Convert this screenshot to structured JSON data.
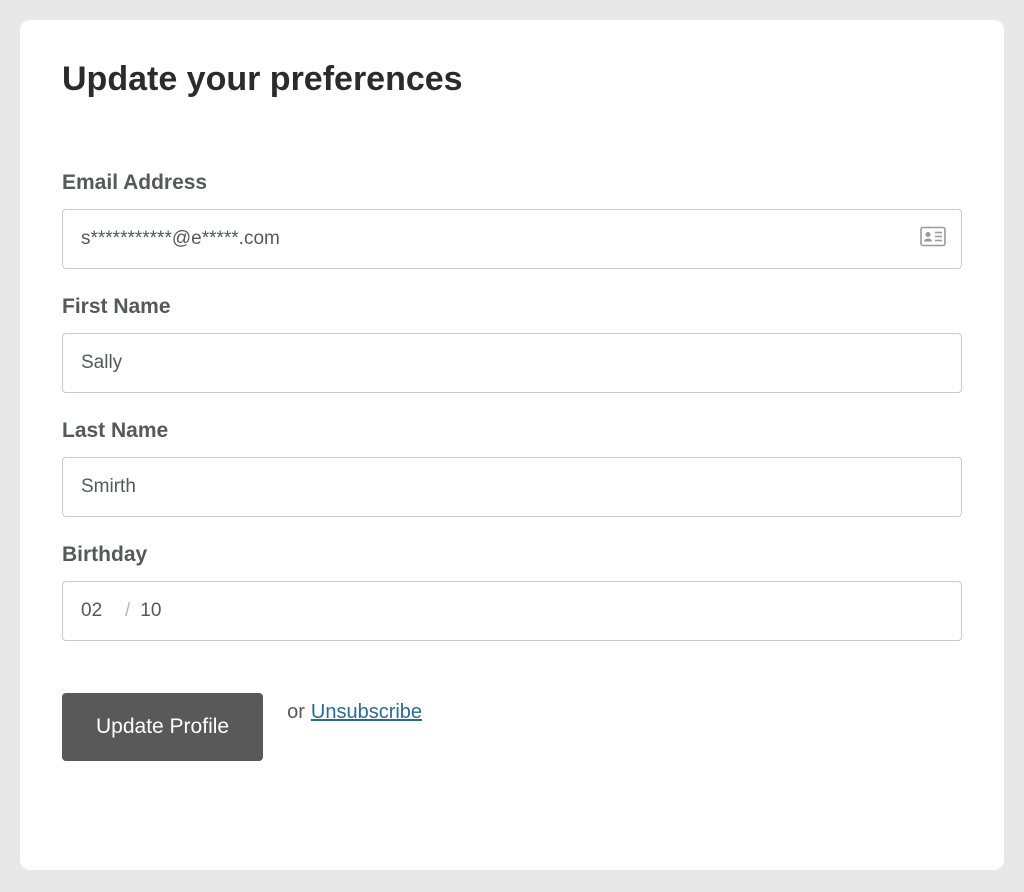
{
  "title": "Update your preferences",
  "fields": {
    "email": {
      "label": "Email Address",
      "value": "s***********@e*****.com"
    },
    "first_name": {
      "label": "First Name",
      "value": "Sally"
    },
    "last_name": {
      "label": "Last Name",
      "value": "Smirth"
    },
    "birthday": {
      "label": "Birthday",
      "month": "02",
      "day": "10",
      "separator": "/"
    }
  },
  "actions": {
    "submit_label": "Update Profile",
    "or_text": "or",
    "unsubscribe_label": "Unsubscribe"
  }
}
